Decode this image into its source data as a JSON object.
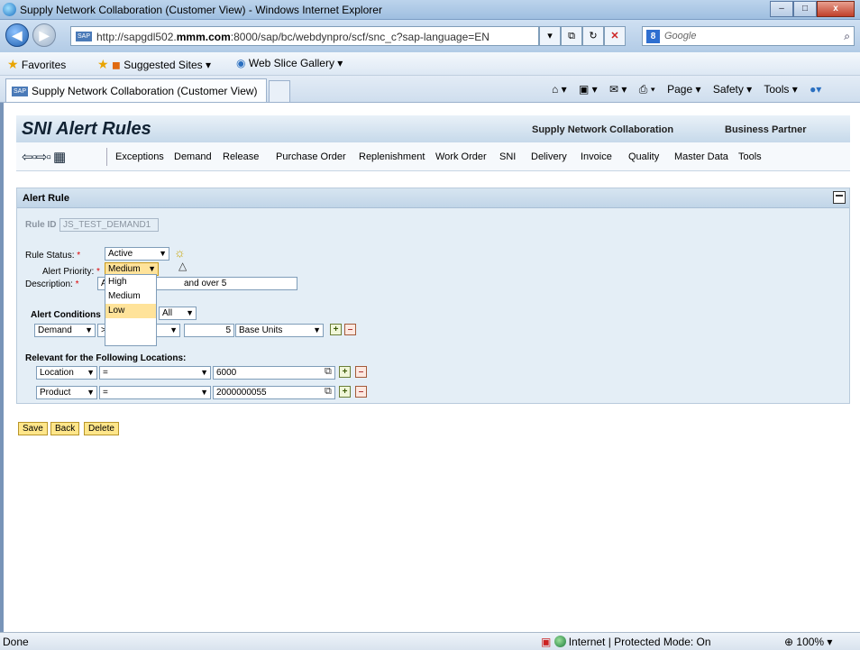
{
  "window": {
    "title": "Supply Network Collaboration (Customer View) - Windows Internet Explorer",
    "min": "–",
    "max": "□",
    "close": "x"
  },
  "address": {
    "url_pre": "http://sapgdl502.",
    "url_bold": "mmm.com",
    "url_post": ":8000/sap/bc/webdynpro/scf/snc_c?sap-language=EN",
    "search_placeholder": "Google"
  },
  "favorites": {
    "favorites": "Favorites",
    "suggested": "Suggested Sites ▾",
    "webslice": "Web Slice Gallery ▾"
  },
  "tab": {
    "label": "Supply Network Collaboration (Customer View)"
  },
  "commandbar": {
    "page": "Page ▾",
    "safety": "Safety ▾",
    "tools": "Tools ▾"
  },
  "app": {
    "title": "SNI Alert Rules",
    "link_snc": "Supply Network Collaboration",
    "link_bp": "Business Partner",
    "menu": [
      "Exceptions",
      "Demand",
      "Release",
      "Purchase Order",
      "Replenishment",
      "Work Order",
      "SNI",
      "Delivery",
      "Invoice",
      "Quality",
      "Master Data",
      "Tools"
    ]
  },
  "panel": {
    "title": "Alert Rule",
    "rule_id_label": "Rule ID",
    "rule_id_value": "JS_TEST_DEMAND1",
    "rule_status_label": "Rule Status:",
    "rule_status_value": "Active",
    "alert_priority_label": "Alert Priority:",
    "alert_priority_value": "Medium",
    "description_label": "Description:",
    "description_value_left": "ALe",
    "description_value_right": "and over 5",
    "alert_conditions_label": "Alert Conditions",
    "alert_conditions_value": "All",
    "condition": {
      "field": "Demand",
      "operator": ">",
      "value": "5",
      "unit": "Base Units"
    },
    "relevant_label": "Relevant for the Following Locations:",
    "locations": [
      {
        "field": "Location",
        "operator": "=",
        "value": "6000"
      },
      {
        "field": "Product",
        "operator": "=",
        "value": "2000000055"
      }
    ],
    "priority_options": [
      "High",
      "Medium",
      "Low"
    ]
  },
  "actions": {
    "save": "Save",
    "back": "Back",
    "delete": "Delete"
  },
  "status": {
    "done": "Done",
    "zone": "Internet | Protected Mode: On",
    "zoom": "100%"
  }
}
